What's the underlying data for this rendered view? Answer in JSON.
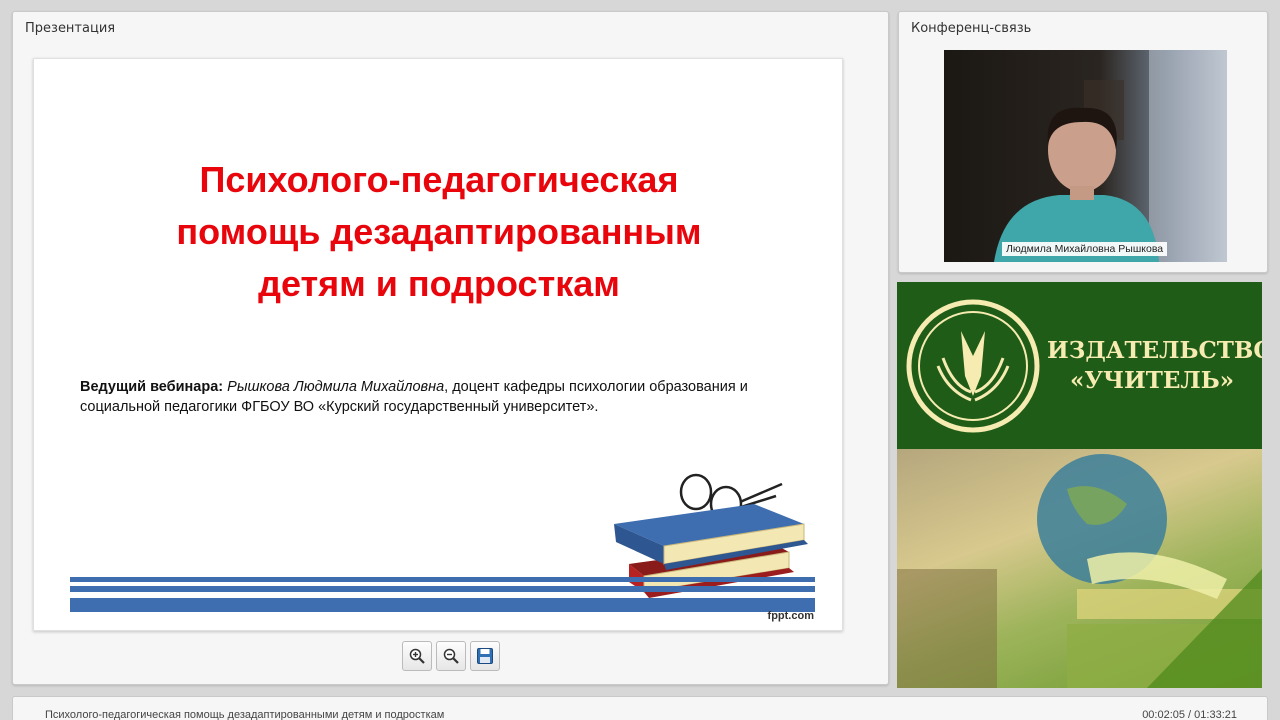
{
  "presentation": {
    "panel_title": "Презентация",
    "slide": {
      "title_lines": [
        "Психолого-педагогическая",
        "помощь дезадаптированным",
        "детям и подросткам"
      ],
      "host_label": "Ведущий вебинара:",
      "host_name": "Рышкова Людмила Михайловна",
      "host_description": ", доцент кафедры психологии образования и социальной педагогики ФГБОУ ВО «Курский государственный университет».",
      "watermark": "fppt.com",
      "title_color": "#e8060c",
      "stripe_color": "#3e6eaf"
    },
    "controls": [
      {
        "name": "zoom-in-button",
        "icon": "zoom-in-icon"
      },
      {
        "name": "zoom-out-button",
        "icon": "zoom-out-icon"
      },
      {
        "name": "save-button",
        "icon": "save-icon"
      }
    ]
  },
  "conference": {
    "panel_title": "Конференц-связь",
    "participant_name": "Людмила Михайловна Рышкова"
  },
  "banner": {
    "line1": "ИЗДАТЕЛЬСТВО",
    "line2": "«УЧИТЕЛЬ»"
  },
  "footer": {
    "title": "Психолого-педагогическая помощь дезадаптированными детям и подросткам",
    "time": "00:02:05 / 01:33:21"
  }
}
